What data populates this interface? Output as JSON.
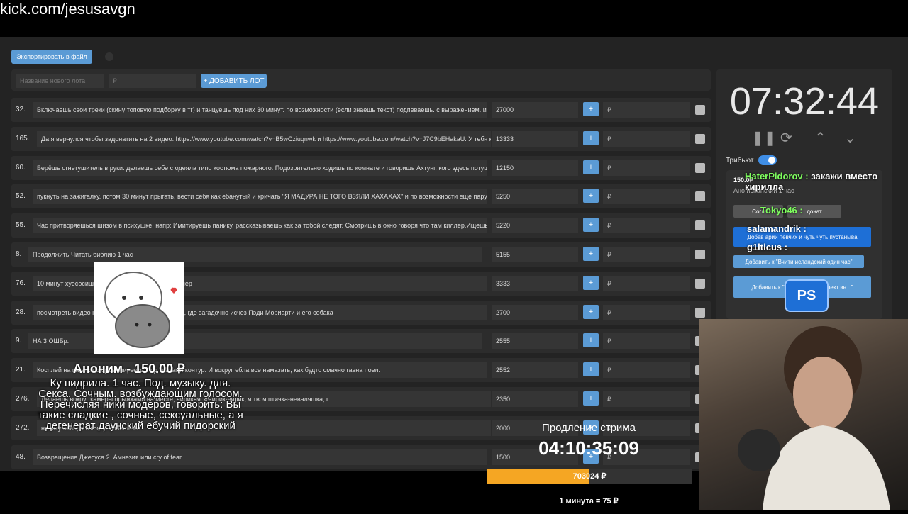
{
  "url": "kick.com/jesusavgn",
  "toolbar": {
    "export_label": "Экспортировать в файл"
  },
  "add_form": {
    "name_placeholder": "Название нового лота",
    "amount_placeholder": "₽",
    "add_label": "+ ДОБАВИТЬ ЛОТ"
  },
  "lots": [
    {
      "num": "32.",
      "text": "Включаешь свои треки (скину топовую подборку в тг) и танцуешь под них 30 минут. по возможности (если знаешь текст) подпеваешь. с выражением. и и",
      "amount": "27000"
    },
    {
      "num": "165.",
      "text": "Да я вернулся чтобы задонатить на 2 видео: https://www.youtube.com/watch?v=B5wCziuqnwk и https://www.youtube.com/watch?v=J7C9bEHakaU. У тебя к",
      "amount": "13333"
    },
    {
      "num": "60.",
      "text": "Берёшь огнетушитель в руки. делаешь себе с одеяла типо костюма пожарного. Подозрительно ходишь по комнате и говоришь Ахтунг. кого здесь потуша",
      "amount": "12150"
    },
    {
      "num": "52.",
      "text": "пукнуть на зажигалку. потом 30 минут прыгать, вести себя как ебанутый и кричать \"Я МАДУРА НЕ ТОГО ВЗЯЛИ ХАХАХАХ\" и по возможности еще пару р",
      "amount": "5250"
    },
    {
      "num": "55.",
      "text": "Час притворяешься шизом в психушке. напр: Имитируешь панику, рассказываешь как за тобой следят. Смотришь в окно говоря что там киллер.Ищешь с",
      "amount": "5220"
    },
    {
      "num": "8.",
      "text": "Продолжить Читать библию 1 час",
      "amount": "5155"
    },
    {
      "num": "76.",
      "text": "10 минут хуесосишь                             с позором, несмотря на таймер",
      "amount": "3333"
    },
    {
      "num": "28.",
      "text": "посмотреть видео на                                 с населением из 11 человек, где загадочно исчез Пэди Мориарти и его собака",
      "amount": "2700"
    },
    {
      "num": "9.",
      "text": "НА 3 ОШБр.",
      "amount": "2555"
    },
    {
      "num": "21.",
      "text": "Косплей на шизика                                   д бровями, веко, под глазами контур. И вокруг ебла все намазать, как будто смачно гавна поел.",
      "amount": "2552"
    },
    {
      "num": "276.",
      "text": "Делаешь                                                  вокруг камеры прыжками на месте, чирикая: «Чирик-чирик, я твоя птичка-неваляшка, г",
      "amount": "2350"
    },
    {
      "num": "272.",
      "text": "                                                              не выучишь, а в конце споёшь её",
      "amount": "2000"
    },
    {
      "num": "48.",
      "text": "Возвращение Джесуса 2. Амнезия или cry of fear",
      "amount": "1500"
    }
  ],
  "rub_placeholder": "₽",
  "timer": {
    "value": "07:32:44"
  },
  "tribute": {
    "label": "Трибьют"
  },
  "card": {
    "amount": "150.0₽",
    "line": "Ано                    испанский 1 час",
    "btn_soglasit": "Согл",
    "btn_donat": "донат"
  },
  "chat": [
    {
      "user": "HaterPidorov :",
      "msg": "закажи вместо кирилла"
    },
    {
      "user": "Tokyo46 :",
      "msg": ""
    },
    {
      "user": "salamandrik :",
      "msg": ""
    },
    {
      "user": "g1lticus :",
      "msg": ""
    }
  ],
  "card_buttons": {
    "b1": "Добав                    арии певчих и чуть чуть пустаныва",
    "b2": "Добавить к \"Вчити исландский один час\"",
    "b3": "Добавить к \"У                  городский диалект                    вн...\""
  },
  "ps_logo": "PS",
  "donation": {
    "donor": "Аноним - 150.00 ₽",
    "message": "Ку пидрила. 1 час. Под. музыку. для. Секса. Сочным. возбуждающим голосом. Перечисляя ники модеров, говорить: Вы такие сладкие , сочные, сексуальные, а я дегенерат даунский ебучий пидорский"
  },
  "extension": {
    "label": "Продление стрима",
    "timer": "04:10:35:09"
  },
  "progress": {
    "label": "703024 ₽",
    "fraction": 0.5
  },
  "rate": "1 минута = 75 ₽"
}
